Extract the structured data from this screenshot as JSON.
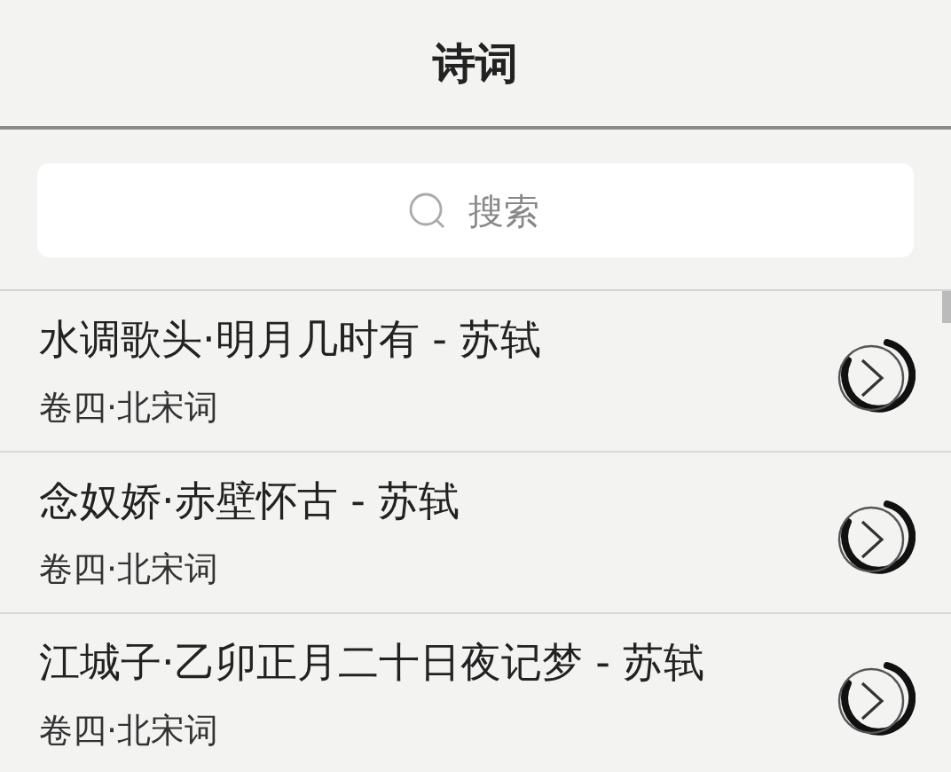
{
  "header": {
    "title": "诗词"
  },
  "search": {
    "placeholder": "搜索"
  },
  "poems": [
    {
      "title": "水调歌头·明月几时有 - 苏轼",
      "source": "卷四·北宋词"
    },
    {
      "title": "念奴娇·赤壁怀古 - 苏轼",
      "source": "卷四·北宋词"
    },
    {
      "title": "江城子·乙卯正月二十日夜记梦 - 苏轼",
      "source": "卷四·北宋词"
    }
  ]
}
